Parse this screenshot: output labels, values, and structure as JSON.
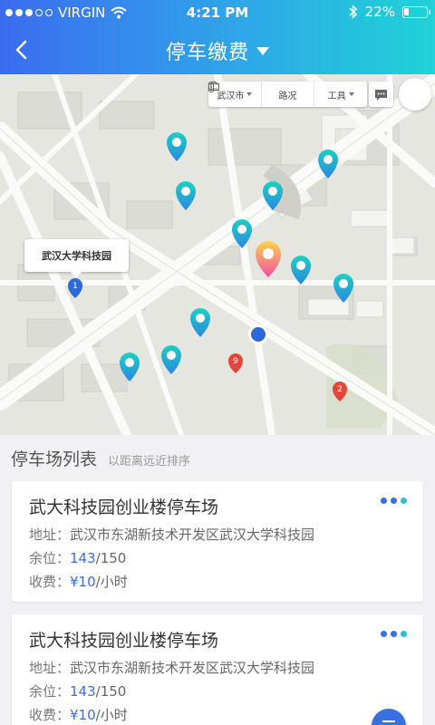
{
  "status_bar": {
    "carrier": "VIRGIN",
    "time": "4:21 PM",
    "battery": "22%",
    "battery_level": 0.22
  },
  "nav": {
    "title": "停车缴费",
    "back_icon": "chevron-left-icon",
    "dropdown_icon": "caret-down-icon"
  },
  "map": {
    "toolbar": {
      "city": "武汉市",
      "traffic": "路况",
      "tools": "工具"
    },
    "callout_label": "武汉大学科技园",
    "markers": [
      {
        "label": "1",
        "color": "#2d69d8"
      },
      {
        "label": "9",
        "color": "#e2473c"
      },
      {
        "label": "2",
        "color": "#e2473c"
      }
    ],
    "pin_colors": {
      "teal": "#18c4c8",
      "blue": "#2a88e0",
      "selected_start": "#ffd24a",
      "selected_end": "#f24fa8"
    }
  },
  "list": {
    "title": "停车场列表",
    "subtitle": "以距离远近排序",
    "items": [
      {
        "name": "武大科技园创业楼停车场",
        "addr_label": "地址：",
        "addr": "武汉市东湖新技术开发区武汉大学科技园",
        "space_label": "余位：",
        "space_free": "143",
        "space_total": "/150",
        "fee_label": "收费：",
        "fee_value": "¥10",
        "fee_unit": "/小时"
      },
      {
        "name": "武大科技园创业楼停车场",
        "addr_label": "地址：",
        "addr": "武汉市东湖新技术开发区武汉大学科技园",
        "space_label": "余位：",
        "space_free": "143",
        "space_total": "/150",
        "fee_label": "收费：",
        "fee_value": "¥10",
        "fee_unit": "/小时"
      }
    ]
  },
  "colors": {
    "accent": "#3a6fe0",
    "header_gradient_start": "#3b6cf0",
    "header_gradient_end": "#1fd3d6"
  }
}
